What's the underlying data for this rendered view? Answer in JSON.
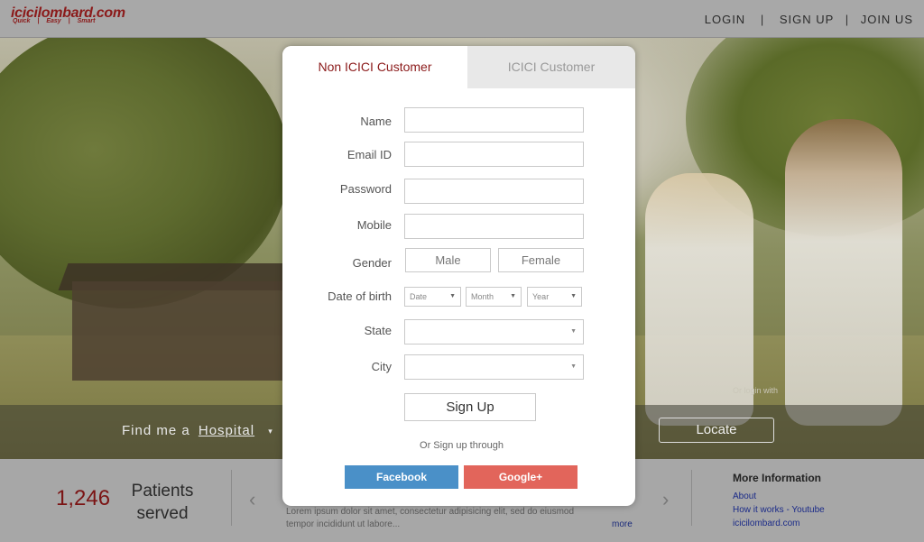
{
  "brand": {
    "logo": "icicilombard.com",
    "tagline": [
      "Quick",
      "|",
      "Easy",
      "|",
      "Smart"
    ]
  },
  "nav": {
    "login": "LOGIN",
    "signup": "SIGN UP",
    "join": "JOIN US",
    "sep": "|"
  },
  "background_text": {
    "or_login_with": "Or login with"
  },
  "hospital_bar": {
    "find_label": "Find me a",
    "selected": "Hospital",
    "caret": "▾",
    "locate_label": "Locate"
  },
  "info_bar": {
    "patients_count": "1,246",
    "patients_label": "Patients served",
    "prev_arrow": "‹",
    "next_arrow": "›",
    "lorem": "Lorem ipsum dolor sit amet, consectetur adipisicing elit, sed do eiusmod tempor incididunt ut labore...",
    "more": "more",
    "more_info": {
      "title": "More Information",
      "links": [
        "About",
        "How it works - Youtube",
        "icicilombard.com"
      ]
    }
  },
  "modal": {
    "tabs": [
      {
        "label": "Non ICICI Customer",
        "active": true
      },
      {
        "label": "ICICI Customer",
        "active": false
      }
    ],
    "fields": {
      "name_label": "Name",
      "email_label": "Email ID",
      "password_label": "Password",
      "mobile_label": "Mobile",
      "gender_label": "Gender",
      "dob_label": "Date of birth",
      "state_label": "State",
      "city_label": "City"
    },
    "gender_options": [
      "Male",
      "Female"
    ],
    "dob": {
      "date": "Date",
      "month": "Month",
      "year": "Year"
    },
    "state_value": "",
    "city_value": "",
    "signup_label": "Sign Up",
    "or_text": "Or Sign up through",
    "facebook_label": "Facebook",
    "google_label": "Google+"
  },
  "colors": {
    "brand_red": "#8b1a1a",
    "facebook": "#4a90c8",
    "google": "#e2655b"
  }
}
